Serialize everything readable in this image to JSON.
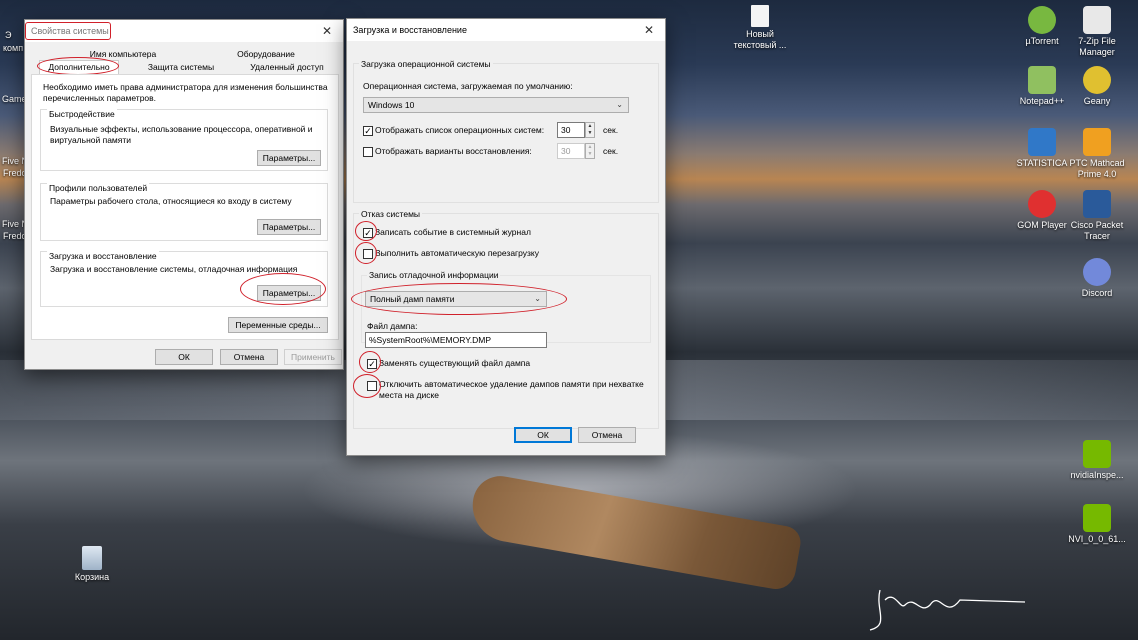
{
  "desktop": {
    "icons_right": [
      {
        "label": "µTorrent",
        "color": "#78b840"
      },
      {
        "label": "7-Zip File Manager",
        "color": "#e8e8e8"
      },
      {
        "label": "Notepad++",
        "color": "#90c060"
      },
      {
        "label": "Geany",
        "color": "#e0c030"
      },
      {
        "label": "STATISTICA",
        "color": "#3078c8"
      },
      {
        "label": "PTC Mathcad Prime 4.0",
        "color": "#f0a020"
      },
      {
        "label": "GOM Player",
        "color": "#e03030"
      },
      {
        "label": "Cisco Packet Tracer",
        "color": "#2a5a9a"
      },
      {
        "label": "Discord",
        "color": "#7289da"
      },
      {
        "label": "nvidiaInspe...",
        "color": "#76b900"
      },
      {
        "label": "NVI_0_0_61...",
        "color": "#76b900"
      }
    ],
    "new_file": "Новый текстовый ...",
    "recycle_bin": "Корзина",
    "left_labels": [
      "Э",
      "комп",
      "Game",
      "Five N",
      "Fredo",
      "Five N",
      "Fredo"
    ]
  },
  "sysprops": {
    "title": "Свойства системы",
    "tabs_top": [
      "Имя компьютера",
      "Оборудование"
    ],
    "tabs_bottom": [
      "Дополнительно",
      "Защита системы",
      "Удаленный доступ"
    ],
    "admin_note": "Необходимо иметь права администратора для изменения большинства перечисленных параметров.",
    "perf": {
      "title": "Быстродействие",
      "desc": "Визуальные эффекты, использование процессора, оперативной и виртуальной памяти",
      "button": "Параметры..."
    },
    "profiles": {
      "title": "Профили пользователей",
      "desc": "Параметры рабочего стола, относящиеся ко входу в систему",
      "button": "Параметры..."
    },
    "startup": {
      "title": "Загрузка и восстановление",
      "desc": "Загрузка и восстановление системы, отладочная информация",
      "button": "Параметры..."
    },
    "env_button": "Переменные среды...",
    "ok": "ОК",
    "cancel": "Отмена",
    "apply": "Применить"
  },
  "recovery": {
    "title": "Загрузка и восстановление",
    "os_section": "Загрузка операционной системы",
    "default_os_label": "Операционная система, загружаемая по умолчанию:",
    "default_os_value": "Windows 10",
    "show_os_list": "Отображать список операционных систем:",
    "show_os_list_value": "30",
    "show_recovery": "Отображать варианты восстановления:",
    "show_recovery_value": "30",
    "sec": "сек.",
    "failure_section": "Отказ системы",
    "write_event": "Записать событие в системный журнал",
    "auto_restart": "Выполнить автоматическую перезагрузку",
    "debug_info_label": "Запись отладочной информации",
    "dump_type": "Полный дамп памяти",
    "dump_file_label": "Файл дампа:",
    "dump_file_value": "%SystemRoot%\\MEMORY.DMP",
    "overwrite": "Заменять существующий файл дампа",
    "disable_autodelete": "Отключить автоматическое удаление дампов памяти при нехватке места на диске",
    "ok": "ОК",
    "cancel": "Отмена"
  }
}
